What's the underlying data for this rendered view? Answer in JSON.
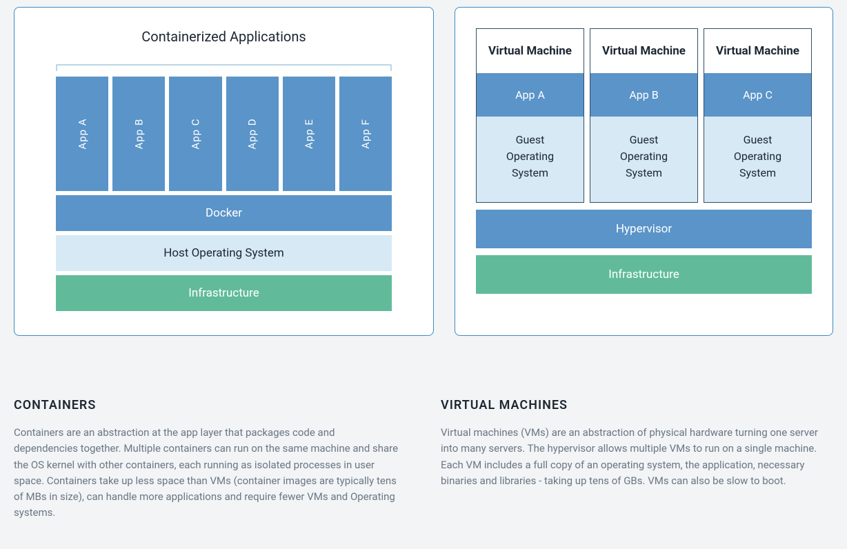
{
  "containers": {
    "title": "Containerized Applications",
    "apps": [
      "App A",
      "App B",
      "App C",
      "App D",
      "App E",
      "App F"
    ],
    "docker_layer": "Docker",
    "host_layer": "Host Operating System",
    "infra_layer": "Infrastructure"
  },
  "vms": {
    "boxes": [
      {
        "title": "Virtual Machine",
        "app": "App A",
        "guest_l1": "Guest",
        "guest_l2": "Operating",
        "guest_l3": "System"
      },
      {
        "title": "Virtual Machine",
        "app": "App B",
        "guest_l1": "Guest",
        "guest_l2": "Operating",
        "guest_l3": "System"
      },
      {
        "title": "Virtual Machine",
        "app": "App C",
        "guest_l1": "Guest",
        "guest_l2": "Operating",
        "guest_l3": "System"
      }
    ],
    "hypervisor_layer": "Hypervisor",
    "infra_layer": "Infrastructure"
  },
  "text": {
    "containers_heading": "CONTAINERS",
    "containers_body": "Containers are an abstraction at the app layer that packages code and dependencies together. Multiple containers can run on the same machine and share the OS kernel with other containers, each running as isolated processes in user space. Containers take up less space than VMs (container images are typically tens of MBs in size), can handle more applications and require fewer VMs and Operating systems.",
    "vms_heading": "VIRTUAL MACHINES",
    "vms_body": "Virtual machines (VMs) are an abstraction of physical hardware turning one server into many servers. The hypervisor allows multiple VMs to run on a single machine. Each VM includes a full copy of an operating system, the application, necessary binaries and libraries - taking up tens of GBs. VMs can also be slow to boot."
  }
}
